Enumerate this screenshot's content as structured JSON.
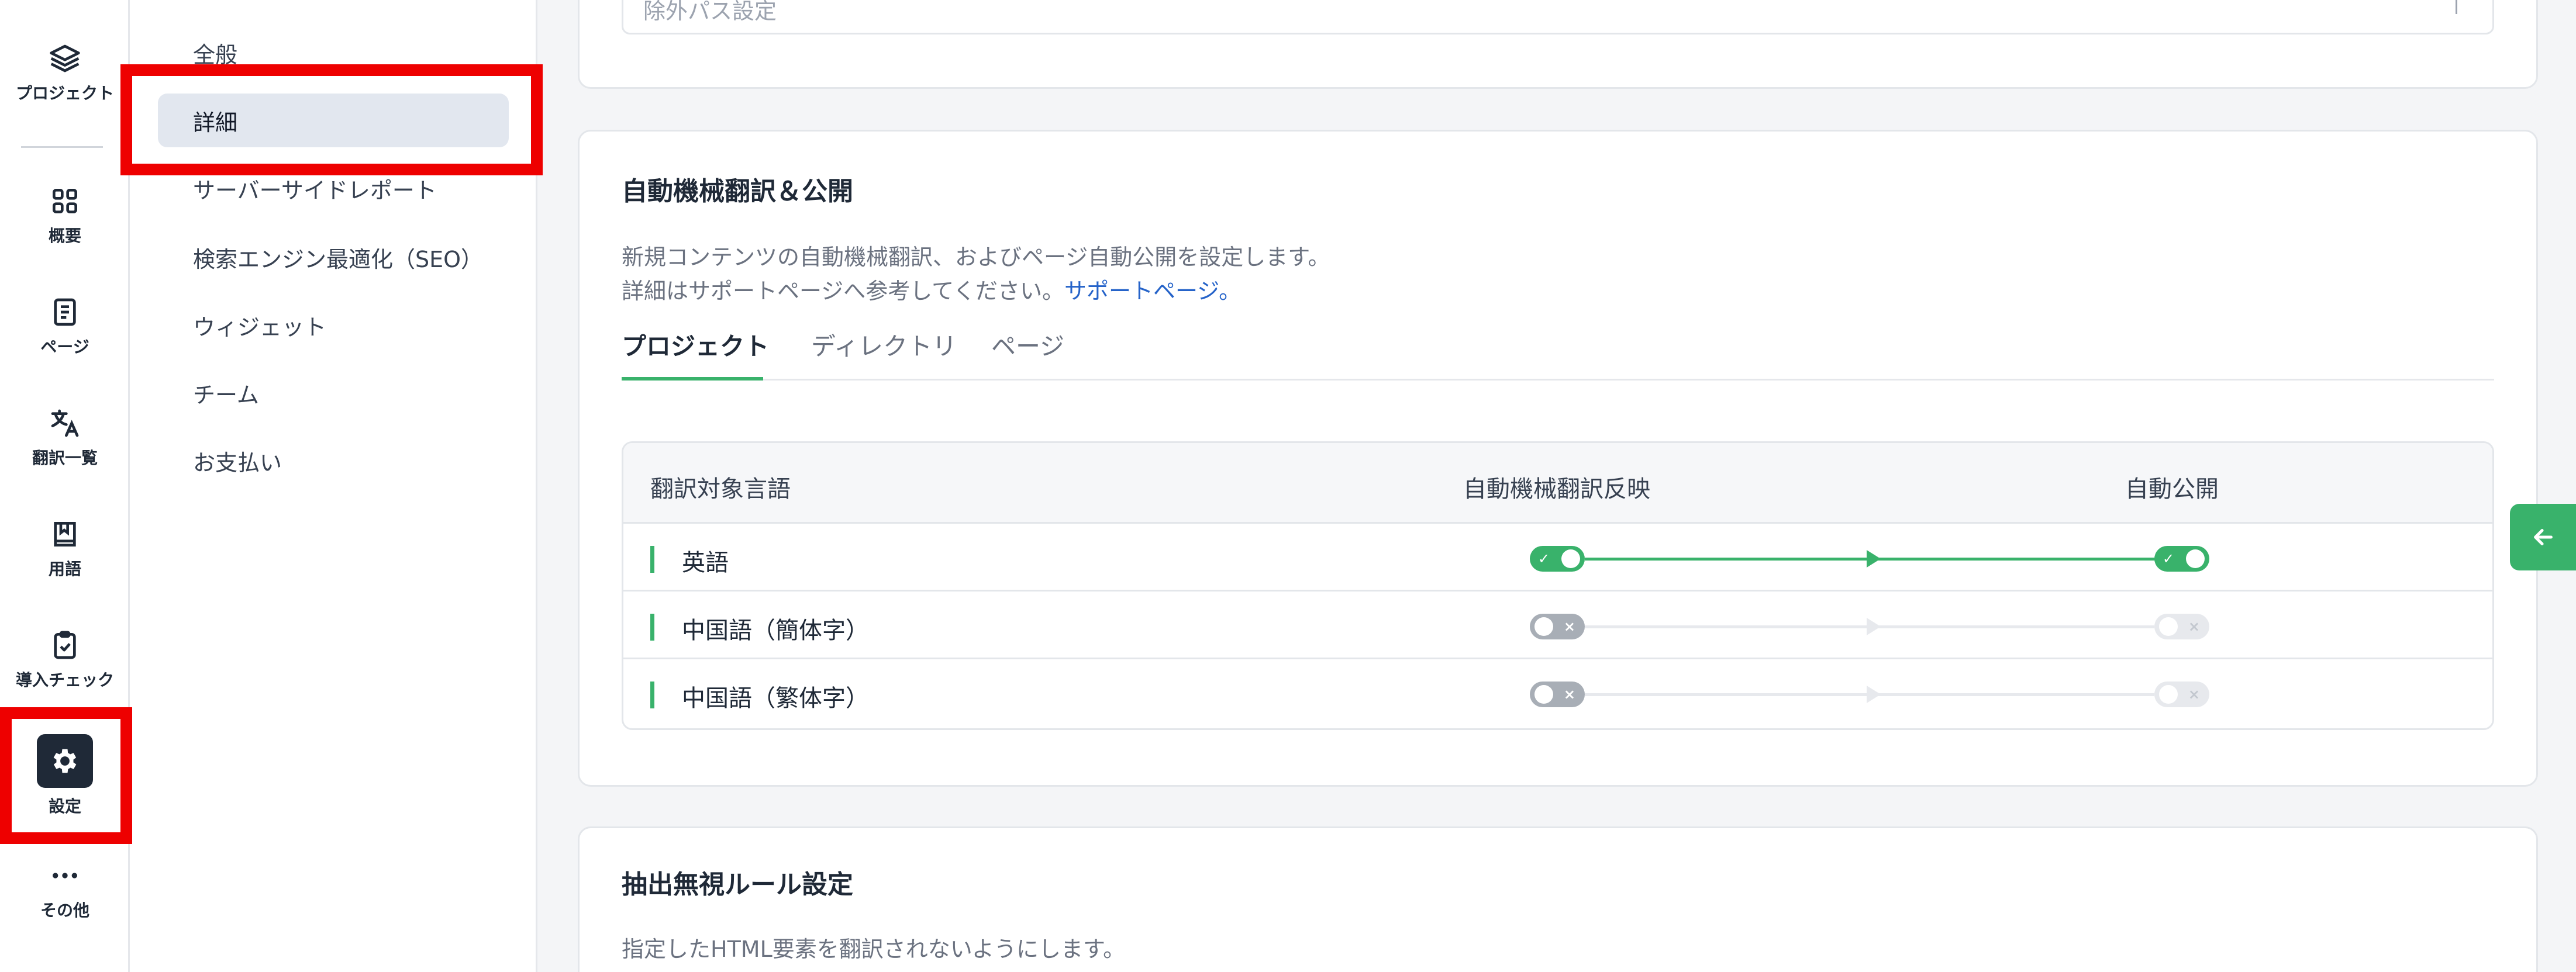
{
  "rail": {
    "items": [
      {
        "label": "プロジェクト",
        "icon": "layers-icon"
      },
      {
        "label": "概要",
        "icon": "grid-icon"
      },
      {
        "label": "ページ",
        "icon": "document-icon"
      },
      {
        "label": "翻訳一覧",
        "icon": "translate-icon"
      },
      {
        "label": "用語",
        "icon": "book-icon"
      },
      {
        "label": "導入チェック",
        "icon": "clipboard-check-icon"
      },
      {
        "label": "設定",
        "icon": "gear-icon",
        "active": true
      },
      {
        "label": "その他",
        "icon": "more-icon"
      }
    ]
  },
  "submenu": {
    "items": [
      {
        "label": "全般"
      },
      {
        "label": "詳細",
        "active": true
      },
      {
        "label": "サーバーサイドレポート"
      },
      {
        "label": "検索エンジン最適化（SEO）"
      },
      {
        "label": "ウィジェット"
      },
      {
        "label": "チーム"
      },
      {
        "label": "お支払い"
      }
    ]
  },
  "prev_card": {
    "partial_label": "除外パス設定"
  },
  "auto_translate": {
    "title": "自動機械翻訳＆公開",
    "desc_line1": "新規コンテンツの自動機械翻訳、およびページ自動公開を設定します。",
    "desc_line2_prefix": "詳細はサポートページへ参考してください。",
    "support_link": "サポートページ。",
    "tabs": [
      {
        "label": "プロジェクト",
        "active": true
      },
      {
        "label": "ディレクトリ"
      },
      {
        "label": "ページ"
      }
    ],
    "table": {
      "headers": [
        "翻訳対象言語",
        "自動機械翻訳反映",
        "自動公開"
      ],
      "rows": [
        {
          "language": "英語",
          "auto_translate": true,
          "auto_publish": true
        },
        {
          "language": "中国語（簡体字）",
          "auto_translate": false,
          "auto_publish": false
        },
        {
          "language": "中国語（繁体字）",
          "auto_translate": false,
          "auto_publish": false
        }
      ]
    }
  },
  "ignore_rules": {
    "title": "抽出無視ルール設定",
    "desc": "指定したHTML要素を翻訳されないようにします。"
  },
  "side_tab": {
    "icon": "arrow-left-icon"
  },
  "colors": {
    "accent": "#39b26b",
    "link": "#2563c9",
    "highlight": "#ee0000",
    "active_bg": "#e2e7ef"
  }
}
